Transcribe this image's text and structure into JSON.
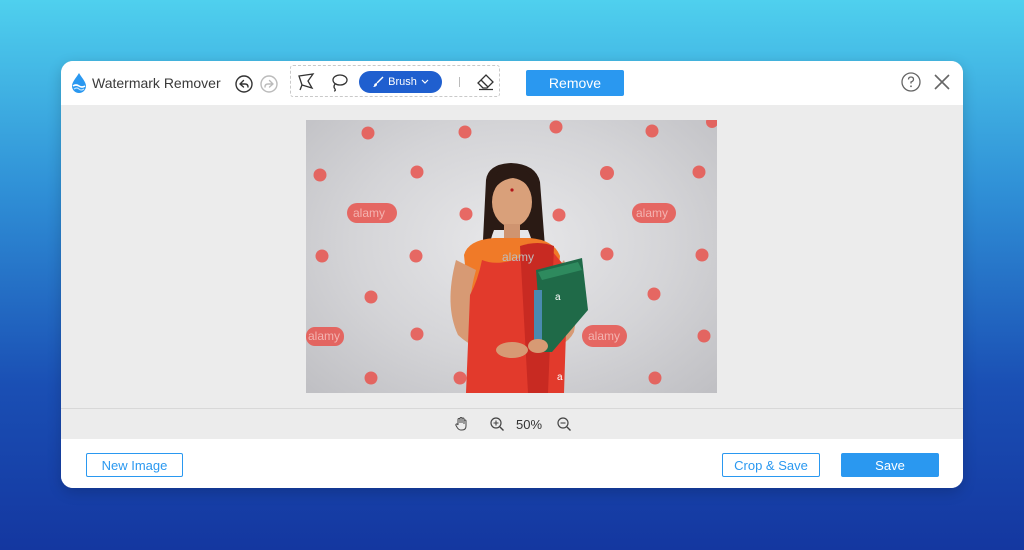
{
  "app": {
    "title": "Watermark Remover",
    "logo_icon": "water-drop-icon",
    "brand_color": "#2a98f0"
  },
  "toolbar": {
    "undo_icon": "undo-icon",
    "redo_icon": "redo-icon",
    "tools": [
      {
        "name": "polygonal-lasso",
        "icon": "polygon-lasso-icon"
      },
      {
        "name": "lasso",
        "icon": "lasso-icon"
      },
      {
        "name": "brush",
        "icon": "brush-icon",
        "label": "Brush",
        "selected": true
      }
    ],
    "eraser_icon": "eraser-icon",
    "remove_label": "Remove",
    "help_icon": "help-icon",
    "close_icon": "close-icon"
  },
  "canvas": {
    "image_description_icon": "photo",
    "watermark_text": "alamy",
    "watermark_letter": "a",
    "highlight_color": "#e8534e"
  },
  "zoom": {
    "hand_icon": "hand-icon",
    "zoom_in_icon": "zoom-in-icon",
    "zoom_out_icon": "zoom-out-icon",
    "value": "50%"
  },
  "footer": {
    "new_image_label": "New Image",
    "crop_save_label": "Crop & Save",
    "save_label": "Save"
  }
}
